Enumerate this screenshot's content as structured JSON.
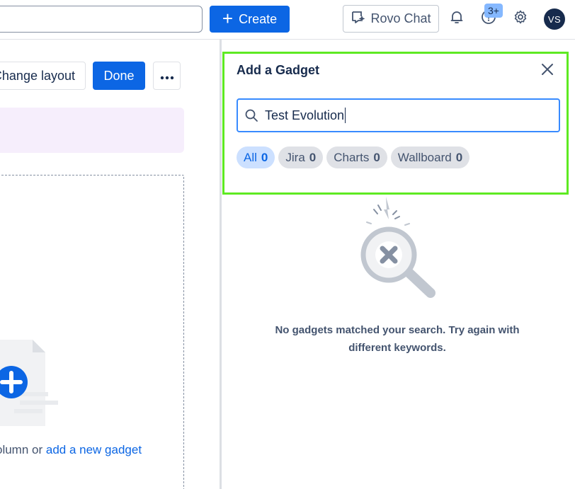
{
  "topbar": {
    "search_value": "",
    "create_label": "Create",
    "rovo_label": "Rovo Chat",
    "help_badge": "3+",
    "avatar_initials": "VS"
  },
  "dashboard": {
    "change_layout_label": "Change layout",
    "done_label": "Done",
    "more_label": "•••",
    "dropzone_prefix": "olumn or",
    "add_gadget_link": "add a new gadget"
  },
  "panel": {
    "title": "Add a Gadget",
    "search_value": "Test Evolution",
    "filters": [
      {
        "label": "All",
        "count": "0",
        "selected": true
      },
      {
        "label": "Jira",
        "count": "0",
        "selected": false
      },
      {
        "label": "Charts",
        "count": "0",
        "selected": false
      },
      {
        "label": "Wallboard",
        "count": "0",
        "selected": false
      }
    ],
    "no_results_message": "No gadgets matched your search. Try again with different keywords."
  },
  "colors": {
    "brand_blue": "#0c66e4",
    "panel_highlight": "#5eea22",
    "selected_chip_bg": "#cce0ff"
  },
  "icons": [
    "search-icon",
    "plus-icon",
    "rovo-chat-icon",
    "bell-icon",
    "help-icon",
    "gear-icon",
    "close-icon",
    "more-icon"
  ]
}
